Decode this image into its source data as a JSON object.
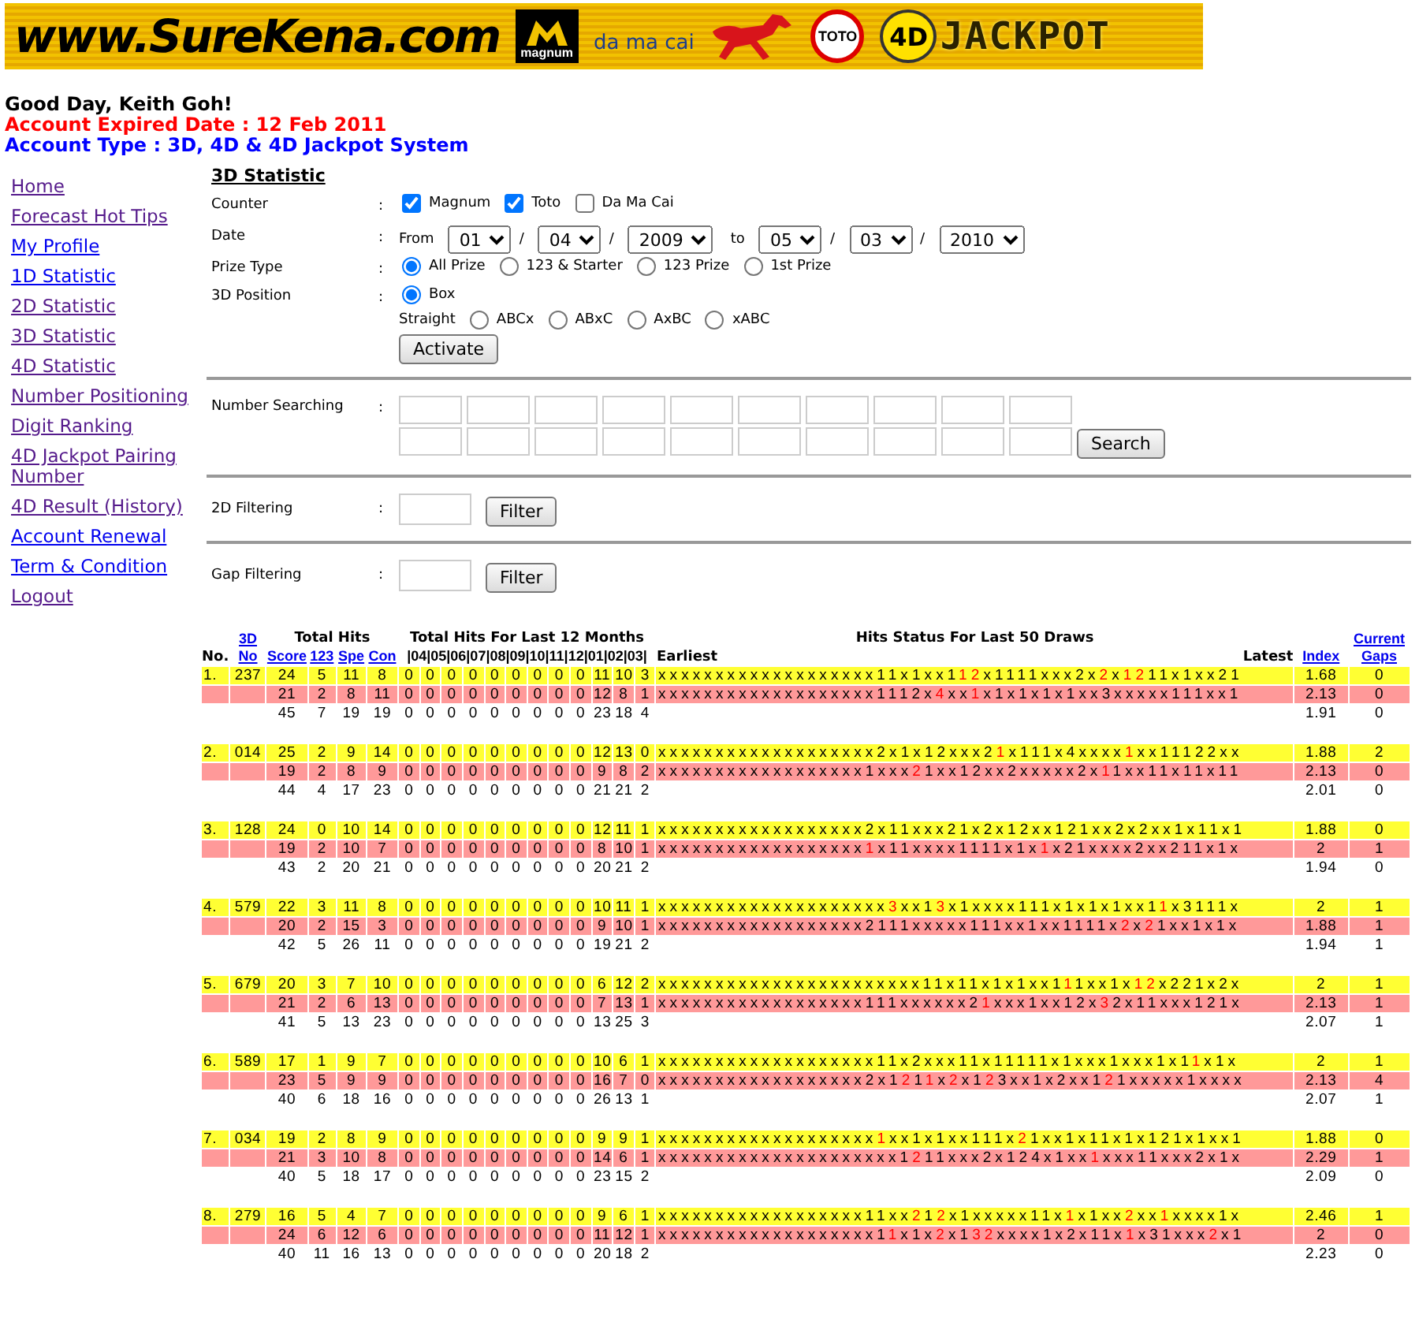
{
  "banner": {
    "site": "www.SureKena.com",
    "logos": [
      {
        "kind": "magnum",
        "label": "magnum"
      },
      {
        "kind": "damacai",
        "label": "da ma cai"
      },
      {
        "kind": "toto",
        "label": "TOTO"
      },
      {
        "kind": "jackpot",
        "prefix": "4D",
        "label": "JACKPOT"
      }
    ]
  },
  "greeting": "Good Day, Keith Goh!",
  "expiry": "Account Expired Date : 12 Feb 2011",
  "account_type": "Account Type : 3D, 4D & 4D Jackpot System",
  "menu": [
    {
      "label": "Home",
      "visited": true
    },
    {
      "label": "Forecast Hot Tips",
      "visited": true
    },
    {
      "label": "My Profile",
      "visited": false
    },
    {
      "label": "1D Statistic",
      "visited": false
    },
    {
      "label": "2D Statistic",
      "visited": true
    },
    {
      "label": "3D Statistic",
      "visited": true
    },
    {
      "label": "4D Statistic",
      "visited": true
    },
    {
      "label": "Number Positioning",
      "visited": true
    },
    {
      "label": "Digit Ranking",
      "visited": true
    },
    {
      "label": "4D Jackpot Pairing Number",
      "visited": true
    },
    {
      "label": "4D Result (History)",
      "visited": true
    },
    {
      "label": "Account Renewal",
      "visited": false
    },
    {
      "label": "Term & Condition",
      "visited": false
    },
    {
      "label": "Logout",
      "visited": true
    }
  ],
  "page_title": "3D Statistic",
  "form": {
    "counter": {
      "label": "Counter",
      "options": [
        {
          "label": "Magnum",
          "checked": true
        },
        {
          "label": "Toto",
          "checked": true
        },
        {
          "label": "Da Ma Cai",
          "checked": false
        }
      ]
    },
    "date": {
      "label": "Date",
      "from_label": "From",
      "from": [
        "01",
        "04",
        "2009"
      ],
      "to_label": "to",
      "to": [
        "05",
        "03",
        "2010"
      ],
      "separator": "/"
    },
    "prize_type": {
      "label": "Prize Type",
      "options": [
        {
          "label": "All Prize",
          "selected": true
        },
        {
          "label": "123 & Starter",
          "selected": false
        },
        {
          "label": "123 Prize",
          "selected": false
        },
        {
          "label": "1st Prize",
          "selected": false
        }
      ]
    },
    "position": {
      "label": "3D Position",
      "box": {
        "label": "Box",
        "selected": true
      },
      "straight_label": "Straight",
      "straight": [
        {
          "label": "ABCx",
          "selected": false
        },
        {
          "label": "ABxC",
          "selected": false
        },
        {
          "label": "AxBC",
          "selected": false
        },
        {
          "label": "xABC",
          "selected": false
        }
      ]
    },
    "activate": "Activate",
    "number_search": {
      "label": "Number Searching",
      "button": "Search"
    },
    "filters": [
      {
        "label": "2D Filtering",
        "button": "Filter"
      },
      {
        "label": "Gap Filtering",
        "button": "Filter"
      }
    ],
    "colon": ":"
  },
  "table": {
    "head": {
      "no": "No.",
      "number": "3D No",
      "total_hits": "Total Hits",
      "cols": [
        "Score",
        "123",
        "Spe",
        "Con"
      ],
      "months_title": "Total Hits For Last 12 Months",
      "months": "|04|05|06|07|08|09|10|11|12|01|02|03|",
      "hits_title": "Hits Status For Last 50 Draws",
      "earliest": "Earliest",
      "latest": "Latest",
      "index": "Index",
      "gaps": "Current Gaps"
    },
    "results": [
      {
        "no": "1.",
        "number": "237",
        "rows": [
          {
            "kind": "counter",
            "color": "#ffff33",
            "vals": [
              "24",
              "5",
              "11",
              "8"
            ],
            "months": [
              "0",
              "0",
              "0",
              "0",
              "0",
              "0",
              "0",
              "0",
              "0",
              "11",
              "10",
              "3"
            ],
            "hits": [
              {
                "text": "xxxxxxxxxxxxxxxxxxx11x1xx1",
                "red": false
              },
              {
                "text": "12",
                "red": true
              },
              {
                "text": "x1111xxx2x",
                "red": false
              },
              {
                "text": "2",
                "red": true
              },
              {
                "text": "x",
                "red": false
              },
              {
                "text": "12",
                "red": true
              },
              {
                "text": "11x1xx21",
                "red": false
              }
            ],
            "index": "1.68",
            "gaps": "0"
          },
          {
            "kind": "counter",
            "color": "#ff9999",
            "vals": [
              "21",
              "2",
              "8",
              "11"
            ],
            "months": [
              "0",
              "0",
              "0",
              "0",
              "0",
              "0",
              "0",
              "0",
              "0",
              "12",
              "8",
              "1"
            ],
            "hits": [
              {
                "text": "xxxxxxxxxxxxxxxxxxx1112x",
                "red": false
              },
              {
                "text": "4",
                "red": true
              },
              {
                "text": "xx",
                "red": false
              },
              {
                "text": "1",
                "red": true
              },
              {
                "text": "x1x1x1x1xx3xxxxx111xx1",
                "red": false
              }
            ],
            "index": "2.13",
            "gaps": "0"
          },
          {
            "kind": "total",
            "vals": [
              "45",
              "7",
              "19",
              "19"
            ],
            "months": [
              "0",
              "0",
              "0",
              "0",
              "0",
              "0",
              "0",
              "0",
              "0",
              "23",
              "18",
              "4"
            ],
            "index": "1.91",
            "gaps": "0"
          }
        ]
      },
      {
        "no": "2.",
        "number": "014",
        "rows": [
          {
            "kind": "counter",
            "color": "#ffff33",
            "vals": [
              "25",
              "2",
              "9",
              "14"
            ],
            "months": [
              "0",
              "0",
              "0",
              "0",
              "0",
              "0",
              "0",
              "0",
              "0",
              "12",
              "13",
              "0"
            ],
            "hits": [
              {
                "text": "xxxxxxxxxxxxxxxxxxx2x1x12xxx2",
                "red": false
              },
              {
                "text": "1",
                "red": true
              },
              {
                "text": "x111x4xxxx",
                "red": false
              },
              {
                "text": "1",
                "red": true
              },
              {
                "text": "xx11122xx",
                "red": false
              }
            ],
            "index": "1.88",
            "gaps": "2"
          },
          {
            "kind": "counter",
            "color": "#ff9999",
            "vals": [
              "19",
              "2",
              "8",
              "9"
            ],
            "months": [
              "0",
              "0",
              "0",
              "0",
              "0",
              "0",
              "0",
              "0",
              "0",
              "9",
              "8",
              "2"
            ],
            "hits": [
              {
                "text": "xxxxxxxxxxxxxxxxxx1xxx",
                "red": false
              },
              {
                "text": "2",
                "red": true
              },
              {
                "text": "1xx12xx2xxxxx2x",
                "red": false
              },
              {
                "text": "1",
                "red": true
              },
              {
                "text": "1xx11x11x11",
                "red": false
              }
            ],
            "index": "2.13",
            "gaps": "0"
          },
          {
            "kind": "total",
            "vals": [
              "44",
              "4",
              "17",
              "23"
            ],
            "months": [
              "0",
              "0",
              "0",
              "0",
              "0",
              "0",
              "0",
              "0",
              "0",
              "21",
              "21",
              "2"
            ],
            "index": "2.01",
            "gaps": "0"
          }
        ]
      },
      {
        "no": "3.",
        "number": "128",
        "rows": [
          {
            "kind": "counter",
            "color": "#ffff33",
            "vals": [
              "24",
              "0",
              "10",
              "14"
            ],
            "months": [
              "0",
              "0",
              "0",
              "0",
              "0",
              "0",
              "0",
              "0",
              "0",
              "12",
              "11",
              "1"
            ],
            "hits": [
              {
                "text": "xxxxxxxxxxxxxxxxxx2x11xxx21x2x12xx121xx2x2xx1x11x1",
                "red": false
              }
            ],
            "index": "1.88",
            "gaps": "0"
          },
          {
            "kind": "counter",
            "color": "#ff9999",
            "vals": [
              "19",
              "2",
              "10",
              "7"
            ],
            "months": [
              "0",
              "0",
              "0",
              "0",
              "0",
              "0",
              "0",
              "0",
              "0",
              "8",
              "10",
              "1"
            ],
            "hits": [
              {
                "text": "xxxxxxxxxxxxxxxxxx",
                "red": false
              },
              {
                "text": "1",
                "red": true
              },
              {
                "text": "x11xxxx1111x1x",
                "red": false
              },
              {
                "text": "1",
                "red": true
              },
              {
                "text": "x21xxxx2xx211x1x",
                "red": false
              }
            ],
            "index": "2",
            "gaps": "1"
          },
          {
            "kind": "total",
            "vals": [
              "43",
              "2",
              "20",
              "21"
            ],
            "months": [
              "0",
              "0",
              "0",
              "0",
              "0",
              "0",
              "0",
              "0",
              "0",
              "20",
              "21",
              "2"
            ],
            "index": "1.94",
            "gaps": "0"
          }
        ]
      },
      {
        "no": "4.",
        "number": "579",
        "rows": [
          {
            "kind": "counter",
            "color": "#ffff33",
            "vals": [
              "22",
              "3",
              "11",
              "8"
            ],
            "months": [
              "0",
              "0",
              "0",
              "0",
              "0",
              "0",
              "0",
              "0",
              "0",
              "10",
              "11",
              "1"
            ],
            "hits": [
              {
                "text": "xxxxxxxxxxxxxxxxxxxx",
                "red": false
              },
              {
                "text": "3",
                "red": true
              },
              {
                "text": "xx1",
                "red": false
              },
              {
                "text": "3",
                "red": true
              },
              {
                "text": "x1xxxx111x1x1x1xx1",
                "red": false
              },
              {
                "text": "1",
                "red": true
              },
              {
                "text": "x3111x",
                "red": false
              }
            ],
            "index": "2",
            "gaps": "1"
          },
          {
            "kind": "counter",
            "color": "#ff9999",
            "vals": [
              "20",
              "2",
              "15",
              "3"
            ],
            "months": [
              "0",
              "0",
              "0",
              "0",
              "0",
              "0",
              "0",
              "0",
              "0",
              "9",
              "10",
              "1"
            ],
            "hits": [
              {
                "text": "xxxxxxxxxxxxxxxxxx2111xxxxx111xx1xx1111x",
                "red": false
              },
              {
                "text": "2",
                "red": true
              },
              {
                "text": "x",
                "red": false
              },
              {
                "text": "2",
                "red": true
              },
              {
                "text": "1xx1x1x",
                "red": false
              }
            ],
            "index": "1.88",
            "gaps": "1"
          },
          {
            "kind": "total",
            "vals": [
              "42",
              "5",
              "26",
              "11"
            ],
            "months": [
              "0",
              "0",
              "0",
              "0",
              "0",
              "0",
              "0",
              "0",
              "0",
              "19",
              "21",
              "2"
            ],
            "index": "1.94",
            "gaps": "1"
          }
        ]
      },
      {
        "no": "5.",
        "number": "679",
        "rows": [
          {
            "kind": "counter",
            "color": "#ffff33",
            "vals": [
              "20",
              "3",
              "7",
              "10"
            ],
            "months": [
              "0",
              "0",
              "0",
              "0",
              "0",
              "0",
              "0",
              "0",
              "0",
              "6",
              "12",
              "2"
            ],
            "hits": [
              {
                "text": "xxxxxxxxxxxxxxxxxxxxxxx11x11x1x1xx1",
                "red": false
              },
              {
                "text": "1",
                "red": true
              },
              {
                "text": "1xx1x",
                "red": false
              },
              {
                "text": "12",
                "red": true
              },
              {
                "text": "x221x2x",
                "red": false
              }
            ],
            "index": "2",
            "gaps": "1"
          },
          {
            "kind": "counter",
            "color": "#ff9999",
            "vals": [
              "21",
              "2",
              "6",
              "13"
            ],
            "months": [
              "0",
              "0",
              "0",
              "0",
              "0",
              "0",
              "0",
              "0",
              "0",
              "7",
              "13",
              "1"
            ],
            "hits": [
              {
                "text": "xxxxxxxxxxxxxxxxxx111xxxxxx2",
                "red": false
              },
              {
                "text": "1",
                "red": true
              },
              {
                "text": "xxx1xx12x",
                "red": false
              },
              {
                "text": "3",
                "red": true
              },
              {
                "text": "2x11xxx121x",
                "red": false
              }
            ],
            "index": "2.13",
            "gaps": "1"
          },
          {
            "kind": "total",
            "vals": [
              "41",
              "5",
              "13",
              "23"
            ],
            "months": [
              "0",
              "0",
              "0",
              "0",
              "0",
              "0",
              "0",
              "0",
              "0",
              "13",
              "25",
              "3"
            ],
            "index": "2.07",
            "gaps": "1"
          }
        ]
      },
      {
        "no": "6.",
        "number": "589",
        "rows": [
          {
            "kind": "counter",
            "color": "#ffff33",
            "vals": [
              "17",
              "1",
              "9",
              "7"
            ],
            "months": [
              "0",
              "0",
              "0",
              "0",
              "0",
              "0",
              "0",
              "0",
              "0",
              "10",
              "6",
              "1"
            ],
            "hits": [
              {
                "text": "xxxxxxxxxxxxxxxxxxx11x2xxx11x11111x1xxx1xxx1x1",
                "red": false
              },
              {
                "text": "1",
                "red": true
              },
              {
                "text": "x1x",
                "red": false
              }
            ],
            "index": "2",
            "gaps": "1"
          },
          {
            "kind": "counter",
            "color": "#ff9999",
            "vals": [
              "23",
              "5",
              "9",
              "9"
            ],
            "months": [
              "0",
              "0",
              "0",
              "0",
              "0",
              "0",
              "0",
              "0",
              "0",
              "16",
              "7",
              "0"
            ],
            "hits": [
              {
                "text": "xxxxxxxxxxxxxxxxxx2x1",
                "red": false
              },
              {
                "text": "2",
                "red": true
              },
              {
                "text": "1",
                "red": false
              },
              {
                "text": "1",
                "red": true
              },
              {
                "text": "x",
                "red": false
              },
              {
                "text": "2",
                "red": true
              },
              {
                "text": "x1",
                "red": false
              },
              {
                "text": "2",
                "red": true
              },
              {
                "text": "3xx1x2xx1",
                "red": false
              },
              {
                "text": "2",
                "red": true
              },
              {
                "text": "1xxxxx1xxxx",
                "red": false
              }
            ],
            "index": "2.13",
            "gaps": "4"
          },
          {
            "kind": "total",
            "vals": [
              "40",
              "6",
              "18",
              "16"
            ],
            "months": [
              "0",
              "0",
              "0",
              "0",
              "0",
              "0",
              "0",
              "0",
              "0",
              "26",
              "13",
              "1"
            ],
            "index": "2.07",
            "gaps": "1"
          }
        ]
      },
      {
        "no": "7.",
        "number": "034",
        "rows": [
          {
            "kind": "counter",
            "color": "#ffff33",
            "vals": [
              "19",
              "2",
              "8",
              "9"
            ],
            "months": [
              "0",
              "0",
              "0",
              "0",
              "0",
              "0",
              "0",
              "0",
              "0",
              "9",
              "9",
              "1"
            ],
            "hits": [
              {
                "text": "xxxxxxxxxxxxxxxxxxx",
                "red": false
              },
              {
                "text": "1",
                "red": true
              },
              {
                "text": "xx1x1xx111x",
                "red": false
              },
              {
                "text": "2",
                "red": true
              },
              {
                "text": "1xx1x11x1x121x1xx1",
                "red": false
              }
            ],
            "index": "1.88",
            "gaps": "0"
          },
          {
            "kind": "counter",
            "color": "#ff9999",
            "vals": [
              "21",
              "3",
              "10",
              "8"
            ],
            "months": [
              "0",
              "0",
              "0",
              "0",
              "0",
              "0",
              "0",
              "0",
              "0",
              "14",
              "6",
              "1"
            ],
            "hits": [
              {
                "text": "xxxxxxxxxxxxxxxxxxxxx1",
                "red": false
              },
              {
                "text": "2",
                "red": true
              },
              {
                "text": "11xxx2x124x1xx",
                "red": false
              },
              {
                "text": "1",
                "red": true
              },
              {
                "text": "xxx11xxx2x1x",
                "red": false
              }
            ],
            "index": "2.29",
            "gaps": "1"
          },
          {
            "kind": "total",
            "vals": [
              "40",
              "5",
              "18",
              "17"
            ],
            "months": [
              "0",
              "0",
              "0",
              "0",
              "0",
              "0",
              "0",
              "0",
              "0",
              "23",
              "15",
              "2"
            ],
            "index": "2.09",
            "gaps": "0"
          }
        ]
      },
      {
        "no": "8.",
        "number": "279",
        "rows": [
          {
            "kind": "counter",
            "color": "#ffff33",
            "vals": [
              "16",
              "5",
              "4",
              "7"
            ],
            "months": [
              "0",
              "0",
              "0",
              "0",
              "0",
              "0",
              "0",
              "0",
              "0",
              "9",
              "6",
              "1"
            ],
            "hits": [
              {
                "text": "xxxxxxxxxxxxxxxxxx11xx",
                "red": false
              },
              {
                "text": "2",
                "red": true
              },
              {
                "text": "1",
                "red": false
              },
              {
                "text": "2",
                "red": true
              },
              {
                "text": "x1xxxxx11x",
                "red": false
              },
              {
                "text": "1",
                "red": true
              },
              {
                "text": "x1xx",
                "red": false
              },
              {
                "text": "2",
                "red": true
              },
              {
                "text": "xx",
                "red": false
              },
              {
                "text": "1",
                "red": true
              },
              {
                "text": "xxxx1x",
                "red": false
              }
            ],
            "index": "2.46",
            "gaps": "1"
          },
          {
            "kind": "counter",
            "color": "#ff9999",
            "vals": [
              "24",
              "6",
              "12",
              "6"
            ],
            "months": [
              "0",
              "0",
              "0",
              "0",
              "0",
              "0",
              "0",
              "0",
              "0",
              "11",
              "12",
              "1"
            ],
            "hits": [
              {
                "text": "xxxxxxxxxxxxxxxxxxx1",
                "red": false
              },
              {
                "text": "1",
                "red": true
              },
              {
                "text": "x1x",
                "red": false
              },
              {
                "text": "2",
                "red": true
              },
              {
                "text": "x1",
                "red": false
              },
              {
                "text": "32",
                "red": true
              },
              {
                "text": "xxxx1x2x11x",
                "red": false
              },
              {
                "text": "1",
                "red": true
              },
              {
                "text": "x31xxx",
                "red": false
              },
              {
                "text": "2",
                "red": true
              },
              {
                "text": "x1",
                "red": false
              }
            ],
            "index": "2",
            "gaps": "0"
          },
          {
            "kind": "total",
            "vals": [
              "40",
              "11",
              "16",
              "13"
            ],
            "months": [
              "0",
              "0",
              "0",
              "0",
              "0",
              "0",
              "0",
              "0",
              "0",
              "20",
              "18",
              "2"
            ],
            "index": "2.23",
            "gaps": "0"
          }
        ]
      }
    ]
  }
}
